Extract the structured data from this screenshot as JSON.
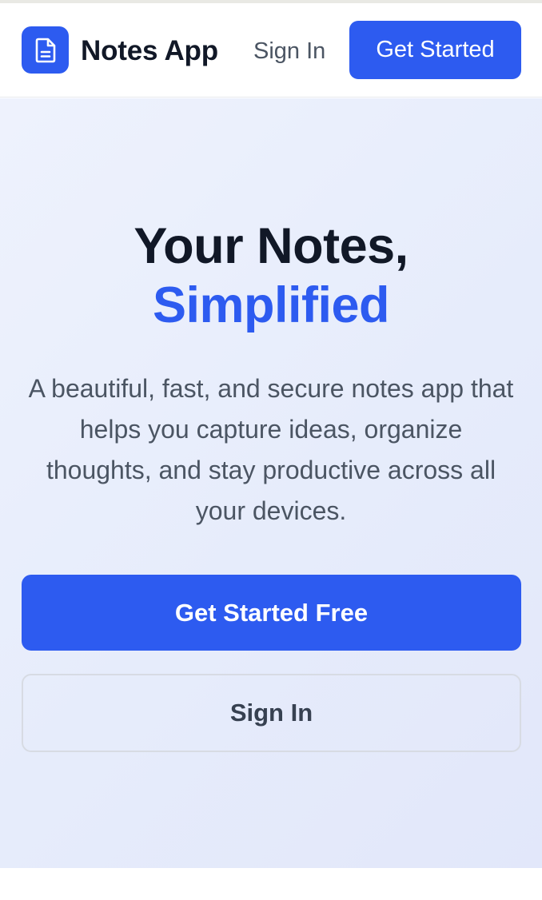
{
  "header": {
    "brand": "Notes App",
    "logo_icon": "document-icon",
    "sign_in_label": "Sign In",
    "get_started_label": "Get Started"
  },
  "hero": {
    "title_line1": "Your Notes,",
    "title_line2": "Simplified",
    "description": "A beautiful, fast, and secure notes app that helps you capture ideas, organize thoughts, and stay productive across all your devices.",
    "primary_cta": "Get Started Free",
    "secondary_cta": "Sign In"
  },
  "colors": {
    "accent": "#2d5bf0",
    "heading": "#111827",
    "body_text": "#4b5563",
    "hero_background": "#e8edfc"
  }
}
